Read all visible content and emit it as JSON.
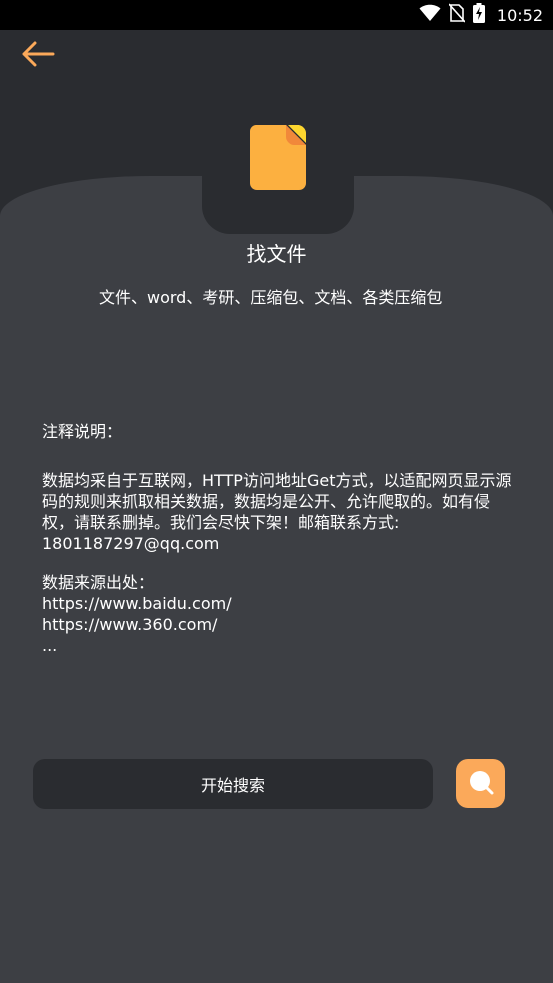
{
  "status_bar": {
    "time": "10:52",
    "icons": [
      "wifi-icon",
      "no-sim-icon",
      "battery-charging-icon"
    ]
  },
  "header": {
    "back_icon": "arrow-left-icon",
    "accent_color": "#fba95a"
  },
  "feature": {
    "icon": "file-icon",
    "title": "找文件",
    "subtitle": "文件、word、考研、压缩包、文档、各类压缩包"
  },
  "notes": {
    "heading": "注释说明：",
    "body": "数据均采自于互联网，HTTP访问地址Get方式，以适配网页显示源码的规则来抓取相关数据，数据均是公开、允许爬取的。如有侵权，请联系删掉。我们会尽快下架！邮箱联系方式: 1801187297@qq.com",
    "sources_heading": "数据来源出处：",
    "sources": [
      "https://www.baidu.com/",
      "https://www.360.com/",
      "..."
    ]
  },
  "actions": {
    "search_label": "开始搜索",
    "search_icon": "search-icon"
  }
}
